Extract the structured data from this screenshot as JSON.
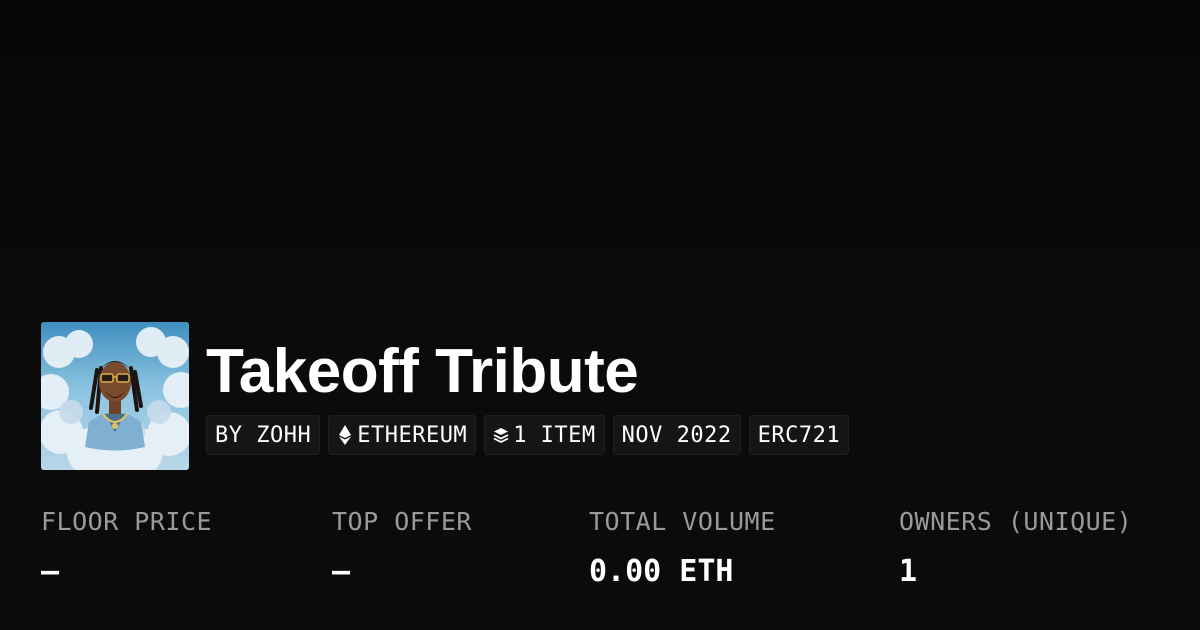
{
  "collection": {
    "title": "Takeoff Tribute",
    "tags": [
      {
        "label": "BY ZOHH",
        "icon": null
      },
      {
        "label": "ETHEREUM",
        "icon": "ethereum-icon"
      },
      {
        "label": "1 ITEM",
        "icon": "layers-icon"
      },
      {
        "label": "NOV 2022",
        "icon": null
      },
      {
        "label": "ERC721",
        "icon": null
      }
    ]
  },
  "stats": {
    "floor_price": {
      "label": "FLOOR PRICE",
      "value": "–"
    },
    "top_offer": {
      "label": "TOP OFFER",
      "value": "–"
    },
    "total_volume": {
      "label": "TOTAL VOLUME",
      "value": "0.00 ETH"
    },
    "owners": {
      "label": "OWNERS (UNIQUE)",
      "value": "1"
    }
  },
  "colors": {
    "background": "#0a0a0a",
    "tag_background": "#151515",
    "label_gray": "#9a9a9a",
    "text": "#ffffff"
  }
}
